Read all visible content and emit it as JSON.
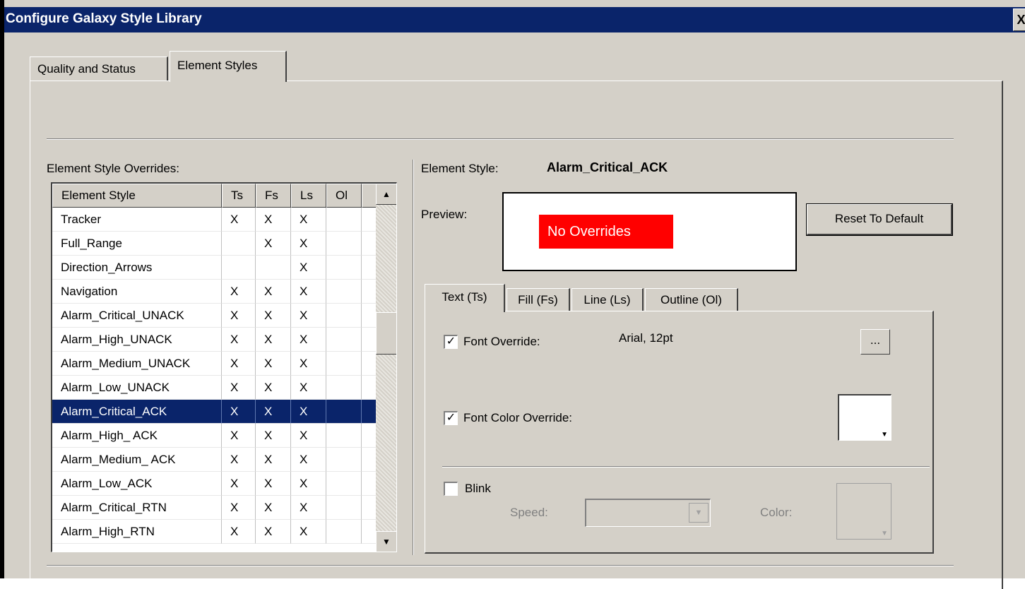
{
  "window": {
    "title": "Configure Galaxy Style Library",
    "close_label": "X"
  },
  "tabs": [
    {
      "label": "Quality and Status",
      "active": false
    },
    {
      "label": "Element Styles",
      "active": true
    }
  ],
  "overrides": {
    "label": "Element Style Overrides:",
    "columns": [
      "Element Style",
      "Ts",
      "Fs",
      "Ls",
      "Ol"
    ],
    "rows": [
      {
        "name": "Tracker",
        "ts": "X",
        "fs": "X",
        "ls": "X",
        "ol": ""
      },
      {
        "name": "Full_Range",
        "ts": "",
        "fs": "X",
        "ls": "X",
        "ol": ""
      },
      {
        "name": "Direction_Arrows",
        "ts": "",
        "fs": "",
        "ls": "X",
        "ol": ""
      },
      {
        "name": "Navigation",
        "ts": "X",
        "fs": "X",
        "ls": "X",
        "ol": ""
      },
      {
        "name": "Alarm_Critical_UNACK",
        "ts": "X",
        "fs": "X",
        "ls": "X",
        "ol": ""
      },
      {
        "name": "Alarm_High_UNACK",
        "ts": "X",
        "fs": "X",
        "ls": "X",
        "ol": ""
      },
      {
        "name": "Alarm_Medium_UNACK",
        "ts": "X",
        "fs": "X",
        "ls": "X",
        "ol": ""
      },
      {
        "name": "Alarm_Low_UNACK",
        "ts": "X",
        "fs": "X",
        "ls": "X",
        "ol": ""
      },
      {
        "name": "Alarm_Critical_ACK",
        "ts": "X",
        "fs": "X",
        "ls": "X",
        "ol": "",
        "selected": true
      },
      {
        "name": "Alarm_High_ ACK",
        "ts": "X",
        "fs": "X",
        "ls": "X",
        "ol": ""
      },
      {
        "name": "Alarm_Medium_ ACK",
        "ts": "X",
        "fs": "X",
        "ls": "X",
        "ol": ""
      },
      {
        "name": "Alarm_Low_ACK",
        "ts": "X",
        "fs": "X",
        "ls": "X",
        "ol": ""
      },
      {
        "name": "Alarm_Critical_RTN",
        "ts": "X",
        "fs": "X",
        "ls": "X",
        "ol": ""
      },
      {
        "name": "Alarm_High_RTN",
        "ts": "X",
        "fs": "X",
        "ls": "X",
        "ol": ""
      }
    ]
  },
  "details": {
    "element_style_label": "Element Style:",
    "element_style_value": "Alarm_Critical_ACK",
    "preview_label": "Preview:",
    "preview_text": "No Overrides",
    "preview_color": "#ff0000",
    "reset_button": "Reset To Default",
    "subtabs": [
      {
        "label": "Text (Ts)",
        "active": true
      },
      {
        "label": "Fill (Fs)",
        "active": false
      },
      {
        "label": "Line (Ls)",
        "active": false
      },
      {
        "label": "Outline (Ol)",
        "active": false
      }
    ],
    "font_override": {
      "label": "Font Override:",
      "checked": true,
      "value": "Arial, 12pt",
      "browse_label": "..."
    },
    "font_color_override": {
      "label": "Font Color Override:",
      "checked": true,
      "color": "#ffffff"
    },
    "blink": {
      "label": "Blink",
      "checked": false,
      "speed_label": "Speed:",
      "speed_value": "",
      "color_label": "Color:"
    }
  },
  "colors": {
    "titlebar": "#0a246a",
    "dialog_bg": "#d4d0c8",
    "selection": "#0a246a"
  }
}
